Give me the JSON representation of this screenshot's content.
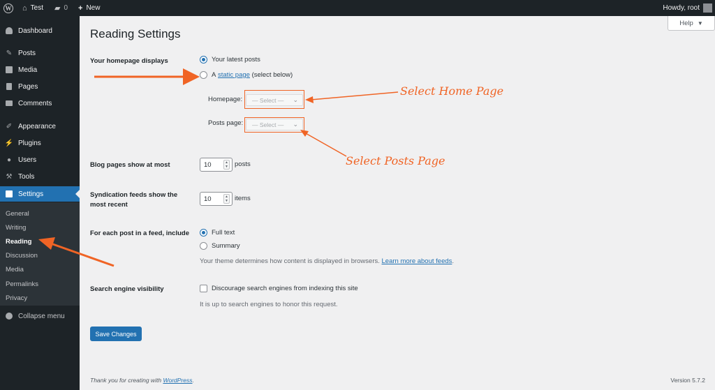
{
  "adminbar": {
    "site_name": "Test",
    "comment_count": "0",
    "new_label": "New",
    "howdy": "Howdy, root"
  },
  "sidebar": {
    "items": [
      {
        "label": "Dashboard",
        "icon": "dashboard-icon"
      },
      {
        "label": "Posts",
        "icon": "pin-icon"
      },
      {
        "label": "Media",
        "icon": "media-icon"
      },
      {
        "label": "Pages",
        "icon": "page-icon"
      },
      {
        "label": "Comments",
        "icon": "comment-icon"
      },
      {
        "label": "Appearance",
        "icon": "brush-icon"
      },
      {
        "label": "Plugins",
        "icon": "plug-icon"
      },
      {
        "label": "Users",
        "icon": "user-icon"
      },
      {
        "label": "Tools",
        "icon": "wrench-icon"
      },
      {
        "label": "Settings",
        "icon": "settings-icon"
      }
    ],
    "submenu": [
      "General",
      "Writing",
      "Reading",
      "Discussion",
      "Media",
      "Permalinks",
      "Privacy"
    ],
    "collapse": "Collapse menu"
  },
  "main": {
    "help": "Help",
    "title": "Reading Settings",
    "homepage_displays": {
      "label": "Your homepage displays",
      "option1": "Your latest posts",
      "option2_prefix": "A",
      "option2_link": "static page",
      "option2_suffix": "(select below)",
      "homepage_label": "Homepage:",
      "postspage_label": "Posts page:",
      "select_placeholder": "— Select —"
    },
    "blog_pages": {
      "label": "Blog pages show at most",
      "value": "10",
      "unit": "posts"
    },
    "syndication": {
      "label_line1": "Syndication feeds show the",
      "label_line2": "most recent",
      "value": "10",
      "unit": "items"
    },
    "feed_include": {
      "label": "For each post in a feed, include",
      "option1": "Full text",
      "option2": "Summary",
      "note": "Your theme determines how content is displayed in browsers.",
      "note_link": "Learn more about feeds"
    },
    "search_visibility": {
      "label": "Search engine visibility",
      "checkbox": "Discourage search engines from indexing this site",
      "note": "It is up to search engines to honor this request."
    },
    "save": "Save Changes",
    "footer_prefix": "Thank you for creating with",
    "footer_link": "WordPress",
    "version": "Version 5.7.2"
  },
  "annotations": {
    "home": "Select Home Page",
    "posts": "Select Posts Page"
  },
  "colors": {
    "accent": "#2271b1",
    "annotation": "#f06425",
    "sidebar_bg": "#1d2327"
  }
}
